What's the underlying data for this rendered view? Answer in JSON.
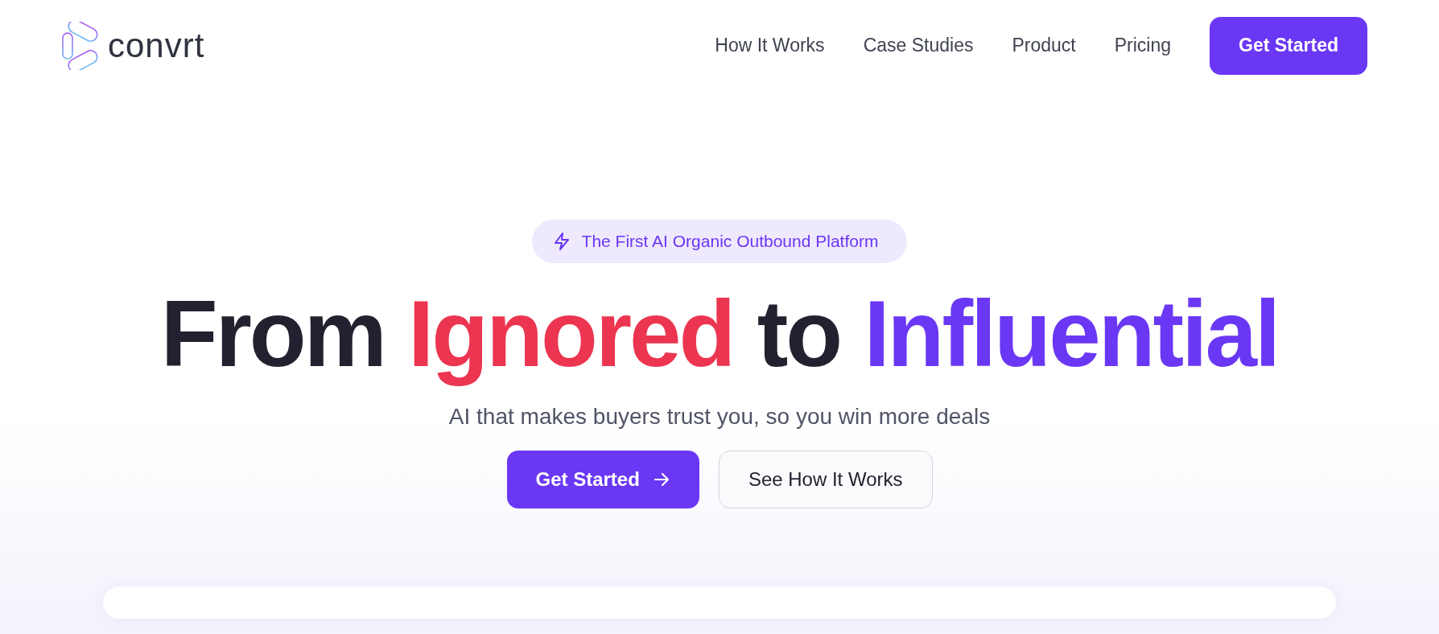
{
  "logo": {
    "text": "convrt"
  },
  "nav": [
    {
      "label": "How It Works"
    },
    {
      "label": "Case Studies"
    },
    {
      "label": "Product"
    },
    {
      "label": "Pricing"
    }
  ],
  "nav_button": "Get Started",
  "badge": "The First AI Organic Outbound Platform",
  "headline": [
    {
      "text": "From",
      "color": "#22212f"
    },
    {
      "text": "Ignored",
      "color": "#ec3550"
    },
    {
      "text": "to",
      "color": "#22212f"
    },
    {
      "text": "Influential",
      "color": "#6a37f5"
    }
  ],
  "subtitle": "AI that makes buyers trust you, so you win more deals",
  "buttons": [
    {
      "label": "Get Started",
      "kind": "primary"
    },
    {
      "label": "See How It Works",
      "kind": "secondary"
    }
  ]
}
